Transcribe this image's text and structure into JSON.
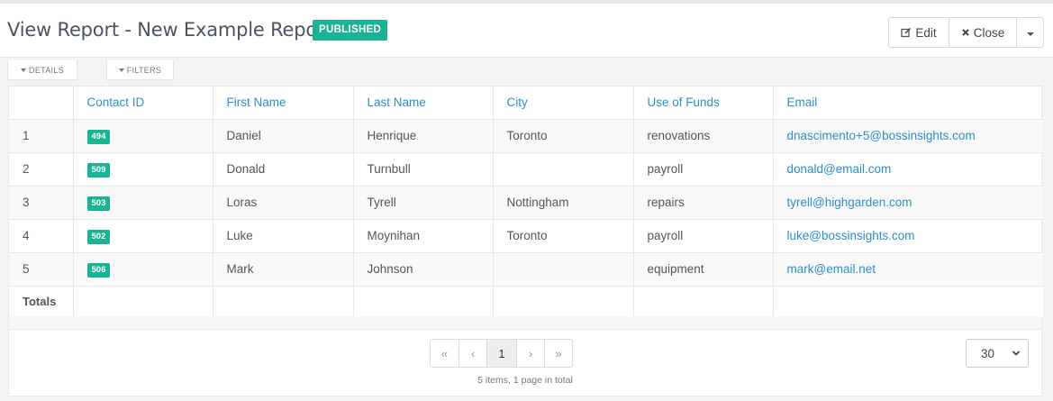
{
  "page": {
    "title": "View Report - New Example Report",
    "status": "PUBLISHED"
  },
  "actions": {
    "edit_label": "Edit",
    "close_label": "Close"
  },
  "toggles": {
    "details": "DETAILS",
    "filters": "FILTERS"
  },
  "table": {
    "columns": [
      "",
      "Contact ID",
      "First Name",
      "Last Name",
      "City",
      "Use of Funds",
      "Email"
    ],
    "rows": [
      {
        "n": "1",
        "id": "494",
        "first": "Daniel",
        "last": "Henrique",
        "city": "Toronto",
        "funds": "renovations",
        "email": "dnascimento+5@bossinsights.com"
      },
      {
        "n": "2",
        "id": "509",
        "first": "Donald",
        "last": "Turnbull",
        "city": "",
        "funds": "payroll",
        "email": "donald@email.com"
      },
      {
        "n": "3",
        "id": "503",
        "first": "Loras",
        "last": "Tyrell",
        "city": "Nottingham",
        "funds": "repairs",
        "email": "tyrell@highgarden.com"
      },
      {
        "n": "4",
        "id": "502",
        "first": "Luke",
        "last": "Moynihan",
        "city": "Toronto",
        "funds": "payroll",
        "email": "luke@bossinsights.com"
      },
      {
        "n": "5",
        "id": "506",
        "first": "Mark",
        "last": "Johnson",
        "city": "",
        "funds": "equipment",
        "email": "mark@email.net"
      }
    ],
    "totals_label": "Totals"
  },
  "pagination": {
    "first": "«",
    "prev": "‹",
    "current": "1",
    "next": "›",
    "last": "»",
    "info": "5 items, 1 page in total",
    "per_page": "30"
  },
  "colors": {
    "accent": "#1ab394",
    "link": "#2e8ec9"
  },
  "icons": {
    "edit": "pencil-square-icon",
    "close": "x-icon",
    "caret": "chevron-down-icon"
  }
}
